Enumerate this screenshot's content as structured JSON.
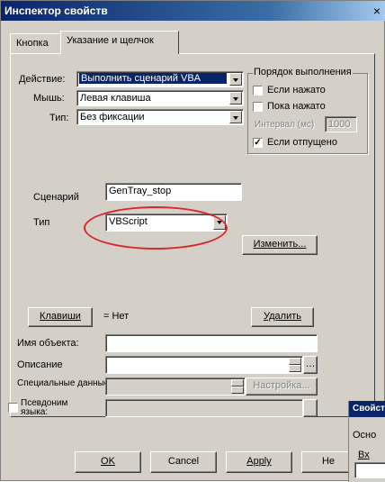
{
  "window": {
    "title": "Инспектор свойств",
    "close_glyph": "×"
  },
  "tabs": [
    {
      "label": "Кнопка"
    },
    {
      "label": "Указание и щелчок",
      "active": true
    }
  ],
  "action": {
    "action_label": "Действие:",
    "action_value": "Выполнить сценарий VBA",
    "mouse_label": "Мышь:",
    "mouse_value": "Левая клавиша",
    "type_label": "Тип:",
    "type_value": "Без фиксации"
  },
  "order": {
    "title": "Порядок выполнения",
    "if_pressed": "Если нажато",
    "while_pressed": "Пока нажато",
    "interval_label": "Интервал (мс)",
    "interval_value": "1000",
    "if_released": "Если отпущено",
    "if_released_checked": true
  },
  "script": {
    "scenario_label": "Сценарий",
    "scenario_value": "GenTray_stop",
    "type_label": "Тип",
    "type_value": "VBScript",
    "change_button": "Изменить..."
  },
  "keys": {
    "keys_button": "Клавиши",
    "keys_value": "= Нет",
    "delete_button": "Удалить"
  },
  "fields": {
    "object_name_label": "Имя объекта:",
    "description_label": "Описание",
    "special_data_label": "Специальные данные:",
    "setup_button": "Настройка...",
    "pseudonym_label": "Псевдоним языка:"
  },
  "buttons": {
    "ok": "OK",
    "cancel": "Cancel",
    "apply": "Apply",
    "help": "He"
  },
  "bg_window": {
    "title": "Свойст",
    "label1": "Осно",
    "label2": "Вх"
  },
  "colors": {
    "highlight": "#0a246a",
    "annotation_oval": "#d9262a"
  }
}
